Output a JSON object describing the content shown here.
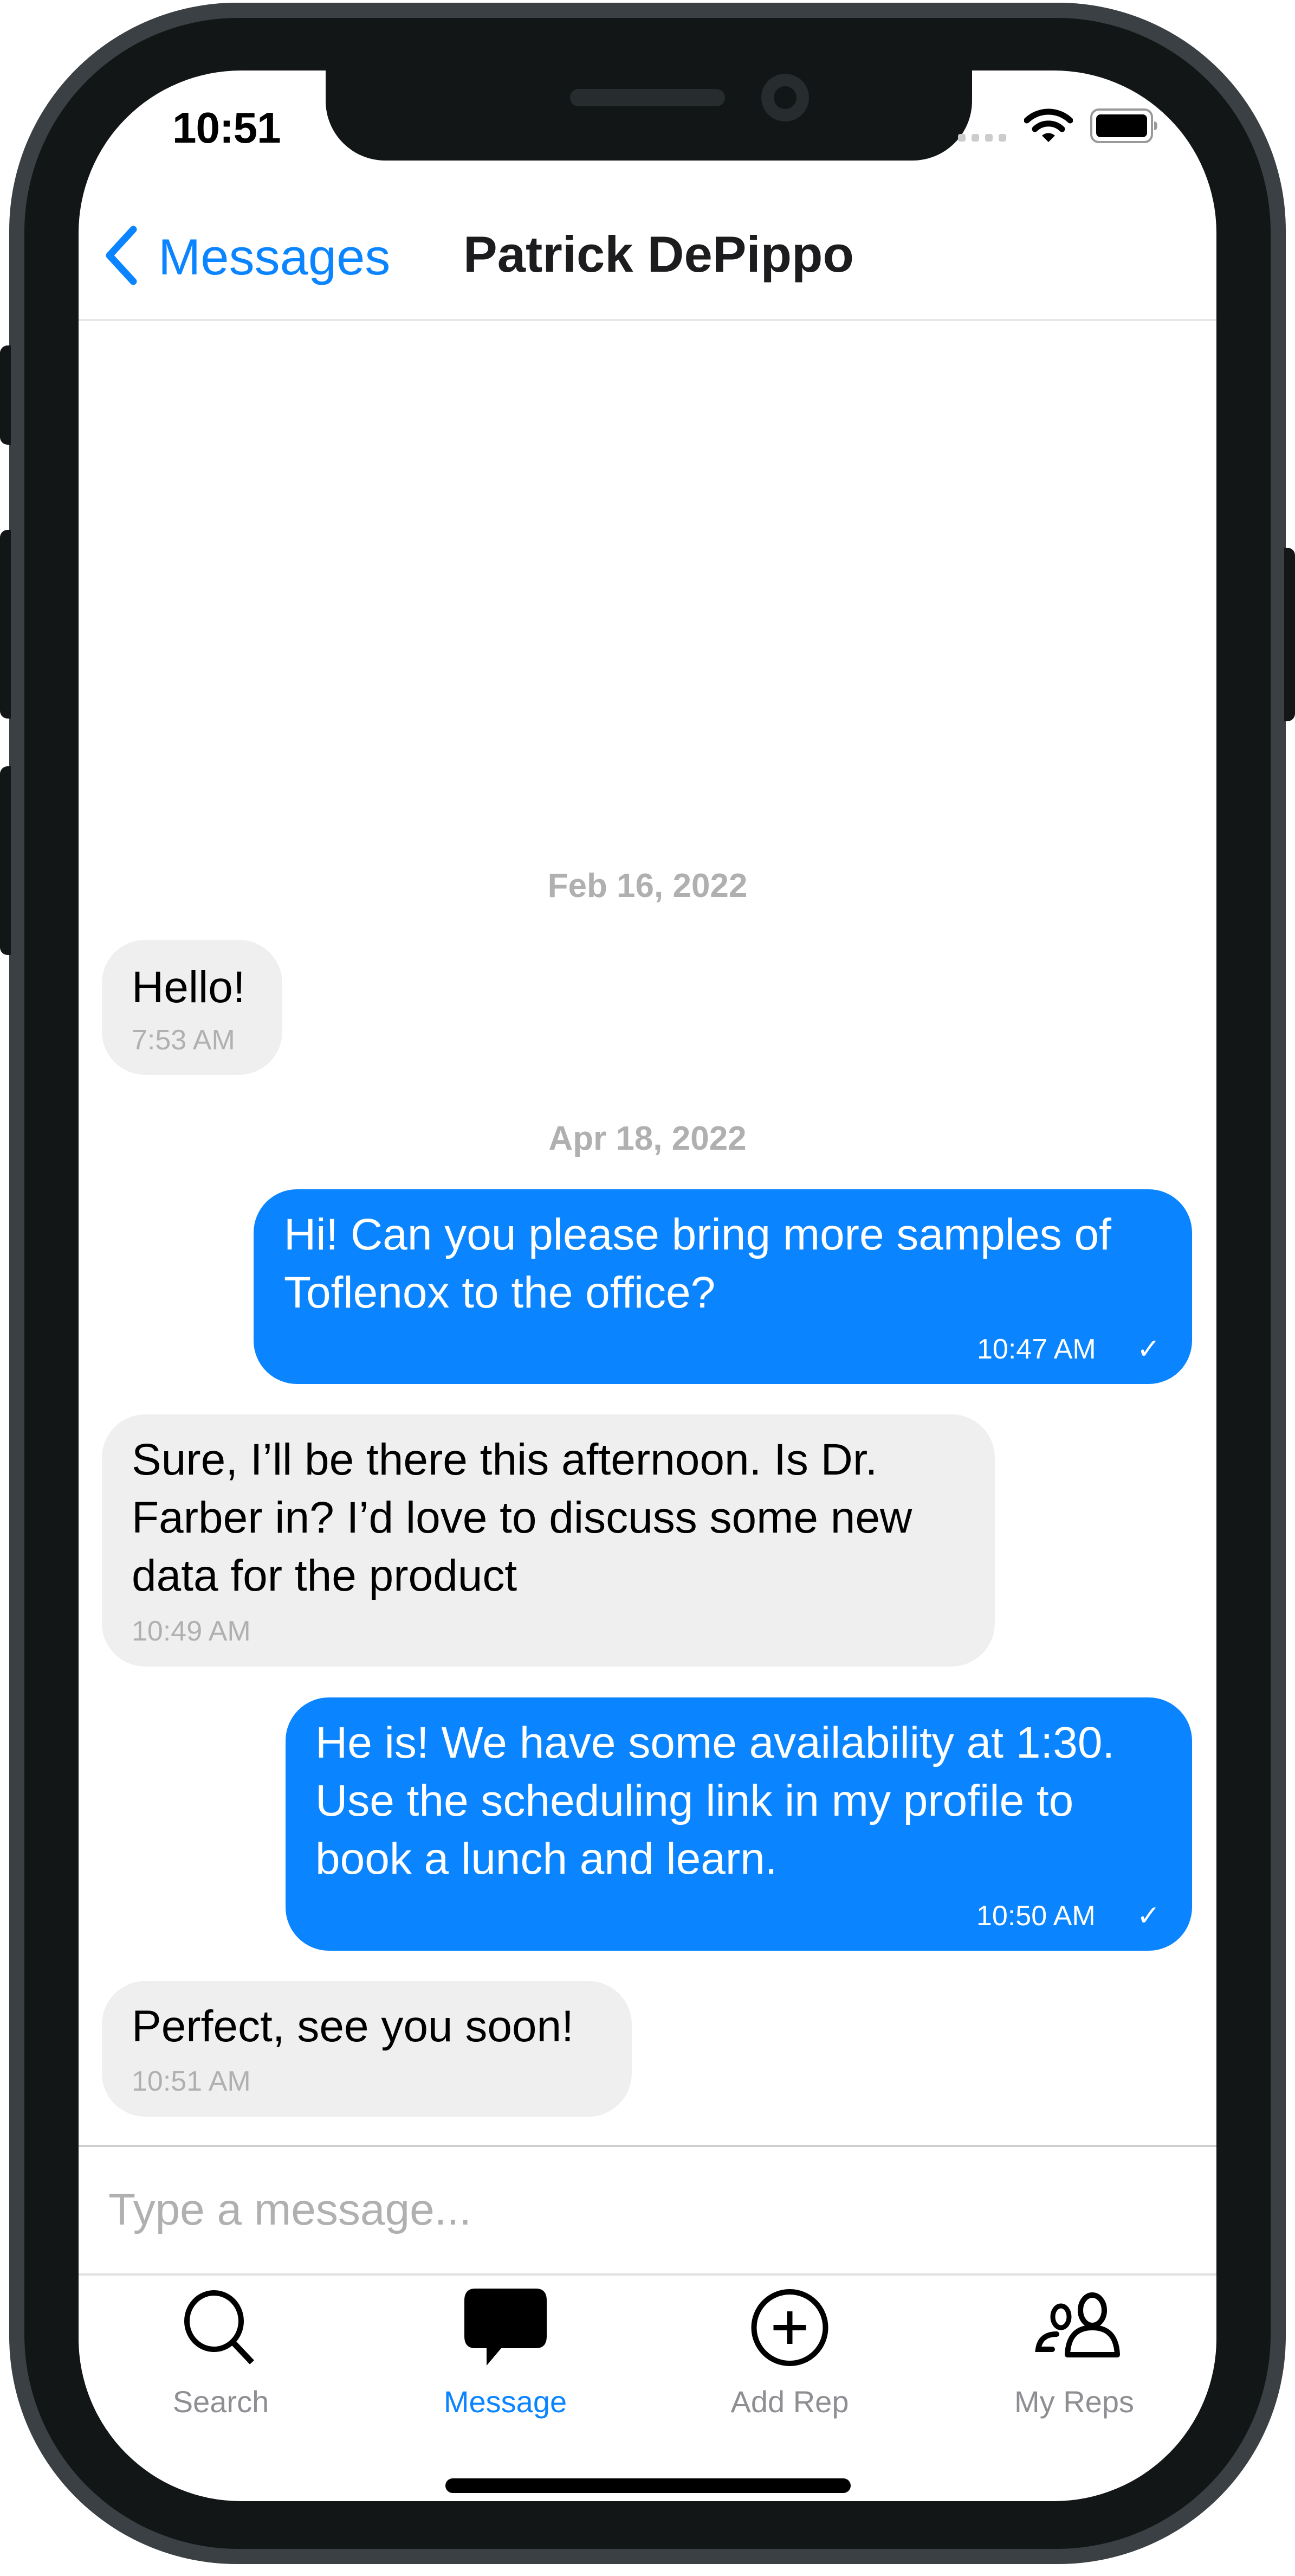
{
  "status_bar": {
    "time": "10:51",
    "signal_icon": "cellular-signal-icon",
    "wifi_icon": "wifi-icon",
    "battery_icon": "battery-icon"
  },
  "nav_bar": {
    "back_icon": "chevron-left-icon",
    "back_label": "Messages",
    "title": "Patrick DePippo"
  },
  "conversation": {
    "date_separators": [
      "Feb 16, 2022",
      "Apr 18, 2022"
    ],
    "messages": [
      {
        "direction": "incoming",
        "text": "Hello!",
        "time": "7:53 AM"
      },
      {
        "direction": "outgoing",
        "text": "Hi! Can you please bring more samples of Toflenox to the office?",
        "time": "10:47 AM",
        "status": "✓"
      },
      {
        "direction": "incoming",
        "text": "Sure, I’ll be there this afternoon. Is Dr. Farber in? I’d love to discuss some new data for the product",
        "time": "10:49 AM"
      },
      {
        "direction": "outgoing",
        "text": "He is! We have some availability at 1:30. Use the scheduling link in my profile to book a lunch and learn.",
        "time": "10:50 AM",
        "status": "✓"
      },
      {
        "direction": "incoming",
        "text": "Perfect, see you soon!",
        "time": "10:51 AM"
      }
    ]
  },
  "composer": {
    "value": "",
    "placeholder": "Type a message..."
  },
  "tab_bar": {
    "active": "Message",
    "tabs": [
      {
        "label": "Search",
        "icon": "search-icon"
      },
      {
        "label": "Message",
        "icon": "message-bubble-icon"
      },
      {
        "label": "Add Rep",
        "icon": "add-circle-icon"
      },
      {
        "label": "My Reps",
        "icon": "people-icon"
      }
    ]
  },
  "colors": {
    "accent": "#0a84ff",
    "incoming_bubble": "#efefef",
    "outgoing_bubble": "#0a84ff",
    "muted_text": "#b0b0b0",
    "tab_inactive": "#8e8e93"
  }
}
